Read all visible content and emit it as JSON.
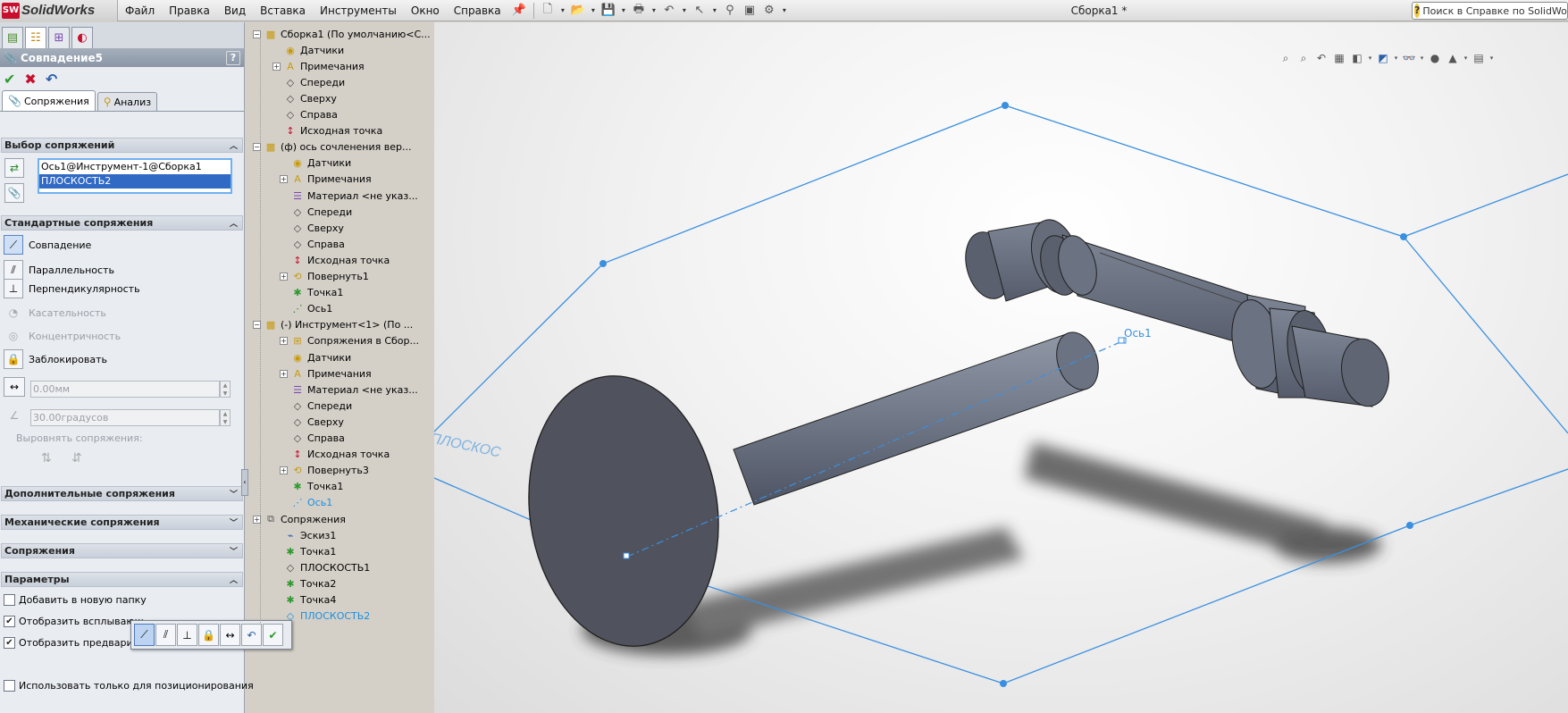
{
  "app": {
    "brand": "SolidWorks",
    "logo_mark": "SW",
    "doc_title": "Сборка1 *"
  },
  "menu": [
    "Файл",
    "Правка",
    "Вид",
    "Вставка",
    "Инструменты",
    "Окно",
    "Справка"
  ],
  "help_search": {
    "placeholder": "Поиск в Справке по SolidWorks"
  },
  "property_manager": {
    "title": "Совпадение5",
    "help": "?",
    "tabs": [
      "Сопряжения",
      "Анализ"
    ],
    "mate_selection": {
      "header": "Выбор сопряжений",
      "items": [
        "Ось1@Инструмент-1@Сборка1",
        "ПЛОСКОСТЬ2"
      ],
      "selected_index": 1
    },
    "standard_mates": {
      "header": "Стандартные сопряжения",
      "items": [
        "Совпадение",
        "Параллельность",
        "Перпендикулярность",
        "Касательность",
        "Концентричность",
        "Заблокировать"
      ],
      "active": "Совпадение",
      "distance": "0.00мм",
      "angle": "30.00градусов",
      "align_label": "Выровнять сопряжения:"
    },
    "collapsed_groups": [
      "Дополнительные сопряжения",
      "Механические сопряжения",
      "Сопряжения"
    ],
    "params": {
      "header": "Параметры",
      "options": [
        {
          "label": "Добавить в новую папку",
          "checked": false
        },
        {
          "label": "Отобразить всплывающ",
          "checked": true
        },
        {
          "label": "Отобразить предварите",
          "checked": true
        },
        {
          "label": "Использовать только для позиционирования",
          "checked": false
        }
      ]
    }
  },
  "tree": {
    "nodes": [
      {
        "label": "Сборка1  (По умолчанию<С...",
        "icon": "assembly-icon",
        "blue": false
      },
      {
        "label": "Датчики",
        "icon": "sensor-icon",
        "blue": false
      },
      {
        "label": "Примечания",
        "icon": "annotation-icon",
        "blue": false
      },
      {
        "label": "Спереди",
        "icon": "plane-icon",
        "blue": false
      },
      {
        "label": "Сверху",
        "icon": "plane-icon",
        "blue": false
      },
      {
        "label": "Справа",
        "icon": "plane-icon",
        "blue": false
      },
      {
        "label": "Исходная точка",
        "icon": "origin-icon",
        "blue": false
      },
      {
        "label": "(ф) ось  сочленения вер...",
        "icon": "part-icon",
        "blue": false
      },
      {
        "label": "Датчики",
        "icon": "sensor-icon",
        "blue": false
      },
      {
        "label": "Примечания",
        "icon": "annotation-icon",
        "blue": false
      },
      {
        "label": "Материал <не указ...",
        "icon": "material-icon",
        "blue": false
      },
      {
        "label": "Спереди",
        "icon": "plane-icon",
        "blue": false
      },
      {
        "label": "Сверху",
        "icon": "plane-icon",
        "blue": false
      },
      {
        "label": "Справа",
        "icon": "plane-icon",
        "blue": false
      },
      {
        "label": "Исходная точка",
        "icon": "origin-icon",
        "blue": false
      },
      {
        "label": "Повернуть1",
        "icon": "revolve-icon",
        "blue": false
      },
      {
        "label": "Точка1",
        "icon": "point-icon",
        "blue": false
      },
      {
        "label": "Ось1",
        "icon": "axis-icon",
        "blue": false
      },
      {
        "label": "(-) Инструмент<1> (По ...",
        "icon": "part-icon",
        "blue": false
      },
      {
        "label": "Сопряжения в Сбор...",
        "icon": "mates-in-assembly-icon",
        "blue": false
      },
      {
        "label": "Датчики",
        "icon": "sensor-icon",
        "blue": false
      },
      {
        "label": "Примечания",
        "icon": "annotation-icon",
        "blue": false
      },
      {
        "label": "Материал <не указ...",
        "icon": "material-icon",
        "blue": false
      },
      {
        "label": "Спереди",
        "icon": "plane-icon",
        "blue": false
      },
      {
        "label": "Сверху",
        "icon": "plane-icon",
        "blue": false
      },
      {
        "label": "Справа",
        "icon": "plane-icon",
        "blue": false
      },
      {
        "label": "Исходная точка",
        "icon": "origin-icon",
        "blue": false
      },
      {
        "label": "Повернуть3",
        "icon": "revolve-icon",
        "blue": false
      },
      {
        "label": "Точка1",
        "icon": "point-icon",
        "blue": false
      },
      {
        "label": "Ось1",
        "icon": "axis-icon",
        "blue": true
      },
      {
        "label": "Сопряжения",
        "icon": "mates-icon",
        "blue": false
      },
      {
        "label": "Эскиз1",
        "icon": "sketch-icon",
        "blue": false
      },
      {
        "label": "Точка1",
        "icon": "point-icon",
        "blue": false
      },
      {
        "label": "ПЛОСКОСТЬ1",
        "icon": "plane-icon",
        "blue": false
      },
      {
        "label": "Точка2",
        "icon": "point-icon",
        "blue": false
      },
      {
        "label": "Точка4",
        "icon": "point-icon",
        "blue": false
      },
      {
        "label": "ПЛОСКОСТЬ2",
        "icon": "plane-icon",
        "blue": true
      }
    ]
  },
  "viewport": {
    "axis_label": "Ось1",
    "plane_label": "ПЛОСКОС"
  },
  "colors": {
    "accent": "#316ac5",
    "plane": "#3a8fe0",
    "part": "#5f6674",
    "select_border": "#6fb0f0"
  }
}
